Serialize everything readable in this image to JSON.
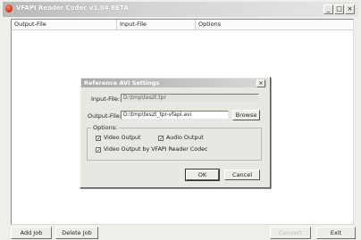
{
  "window": {
    "title": "VFAPI Reader Codec v1.04 BETA",
    "controls": {
      "minimize": "_",
      "maximize": "□",
      "close": "×"
    }
  },
  "list": {
    "columns": [
      "Output-File",
      "Input-File",
      "Options"
    ]
  },
  "bottom_buttons": {
    "add_job": "Add Job",
    "delete_job": "Delete Job",
    "convert": "Convert",
    "exit": "Exit"
  },
  "dialog": {
    "title": "Reference AVI Settings",
    "close": "×",
    "input_file_label": "Input-File:",
    "input_file_value": "D:\\tmp\\teszt.tpr",
    "output_file_label": "Output-File:",
    "output_file_value": "D:\\tmp\\teszt_tpr-vfapi.avi",
    "browse_label": "Browse",
    "options_label": "Options:",
    "options": [
      {
        "label": "Video Output",
        "checked": true
      },
      {
        "label": "Audio Output",
        "checked": true
      },
      {
        "label": "Video Output by VFAPI Reader Codec",
        "checked": true
      }
    ],
    "ok_label": "OK",
    "cancel_label": "Cancel"
  },
  "colors": {
    "titlebar": "#c8c8c8",
    "window_bg": "#f0eee8",
    "app_icon": "#e33b1b"
  }
}
